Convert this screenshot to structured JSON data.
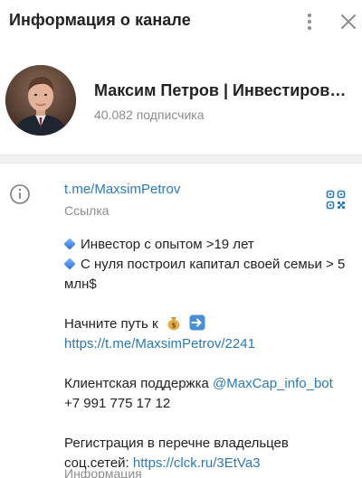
{
  "header": {
    "title": "Информация о канале",
    "menu_icon": "more-vertical-icon",
    "close_icon": "close-icon"
  },
  "profile": {
    "name": "Максим Петров | Инвестиров…",
    "subscribers": "40.082 подписчика"
  },
  "info": {
    "link": "t.me/MaxsimPetrov",
    "link_label": "Ссылка",
    "desc": {
      "line1": "Инвестор с опытом >19 лет",
      "line2": "С нуля построил капитал своей семьи > 5 млн$",
      "start_text": "Начните путь к",
      "start_link": "https://t.me/MaxsimPetrov/2241",
      "support_text": "Клиентская поддержка",
      "support_bot": "@MaxCap_info_bot",
      "phone": "+7 991 775 17 12",
      "reg_text": "Регистрация в перечне владельцев соц.сетей:",
      "reg_link": "https://clck.ru/3EtVa3"
    },
    "desc_label": "Информация"
  },
  "colors": {
    "accent": "#2a7ab8",
    "muted": "#8c8c8c",
    "divider": "#f1f1f1"
  }
}
